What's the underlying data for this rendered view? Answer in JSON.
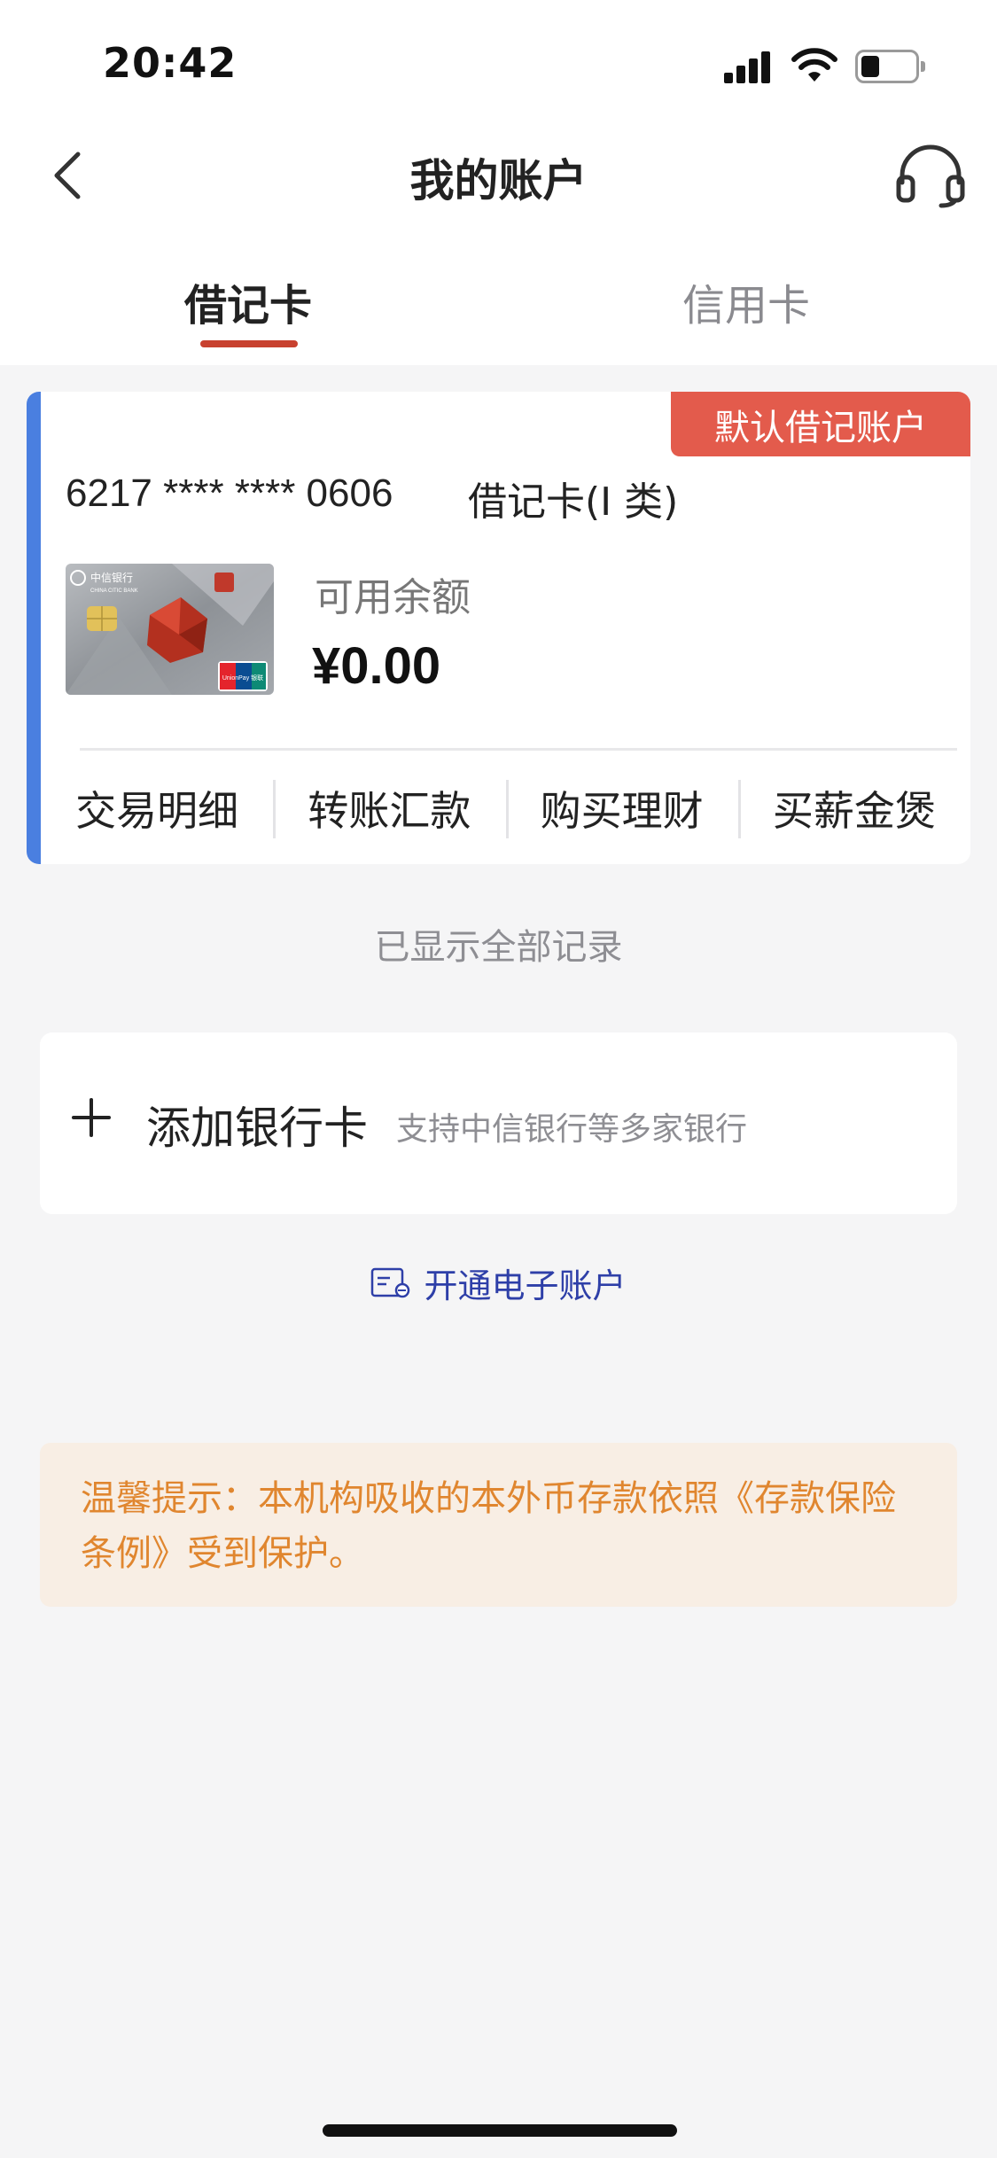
{
  "status_bar": {
    "time": "20:42"
  },
  "header": {
    "title": "我的账户"
  },
  "tabs": [
    {
      "label": "借记卡",
      "active": true
    },
    {
      "label": "信用卡",
      "active": false
    }
  ],
  "account_card": {
    "badge": "默认借记账户",
    "card_number": "6217 **** **** 0606",
    "card_type": "借记卡(I 类)",
    "balance_label": "可用余额",
    "balance_value": "¥0.00",
    "actions": [
      {
        "label": "交易明细"
      },
      {
        "label": "转账汇款"
      },
      {
        "label": "购买理财"
      },
      {
        "label": "买薪金煲"
      }
    ],
    "card_image": {
      "bank_name": "中信银行",
      "bank_name_en": "CHINA CITIC BANK",
      "logo_text": "UnionPay 银联"
    }
  },
  "records_status": "已显示全部记录",
  "add_card": {
    "label": "添加银行卡",
    "hint": "支持中信银行等多家银行"
  },
  "open_e_account": {
    "label": "开通电子账户"
  },
  "notice": {
    "text": "温馨提示：本机构吸收的本外币存款依照《存款保险条例》受到保护。"
  },
  "colors": {
    "accent_red": "#c8412f",
    "badge_red": "#e35b4c",
    "card_accent_blue": "#4a7fe0",
    "link_blue": "#2e3fa8",
    "notice_orange": "#e0862f",
    "notice_bg": "#f8eee4"
  },
  "icons": {
    "back": "chevron-left-icon",
    "service": "headset-icon",
    "add": "plus-icon",
    "e_account": "e-card-icon"
  }
}
